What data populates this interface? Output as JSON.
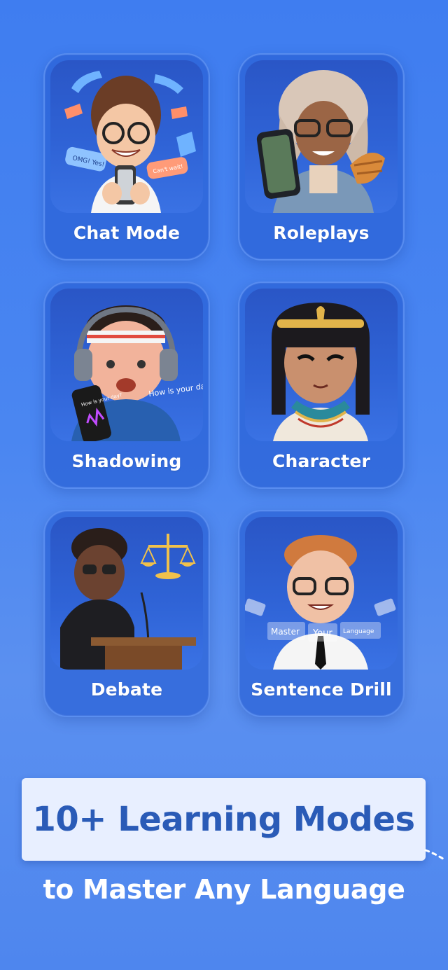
{
  "modes": [
    {
      "label": "Chat Mode",
      "icon": "chat-avatar-icon"
    },
    {
      "label": "Roleplays",
      "icon": "roleplay-avatar-icon"
    },
    {
      "label": "Shadowing",
      "icon": "shadowing-avatar-icon"
    },
    {
      "label": "Character",
      "icon": "character-avatar-icon"
    },
    {
      "label": "Debate",
      "icon": "debate-avatar-icon"
    },
    {
      "label": "Sentence Drill",
      "icon": "sentence-drill-avatar-icon"
    }
  ],
  "art_text": {
    "chat_bubble_1": "OMG! Yes!",
    "chat_bubble_2": "Can't wait!",
    "phone_text": "How is your day?",
    "speech_text": "How is your day?",
    "drill_word_1": "Master",
    "drill_word_2": "Your",
    "drill_word_3": "Language"
  },
  "banner": {
    "title": "10+ Learning Modes"
  },
  "subtitle": "to Master Any Language",
  "colors": {
    "accent": "#2a5bb7",
    "background": "#4a86f1",
    "card": "#2961d6"
  }
}
